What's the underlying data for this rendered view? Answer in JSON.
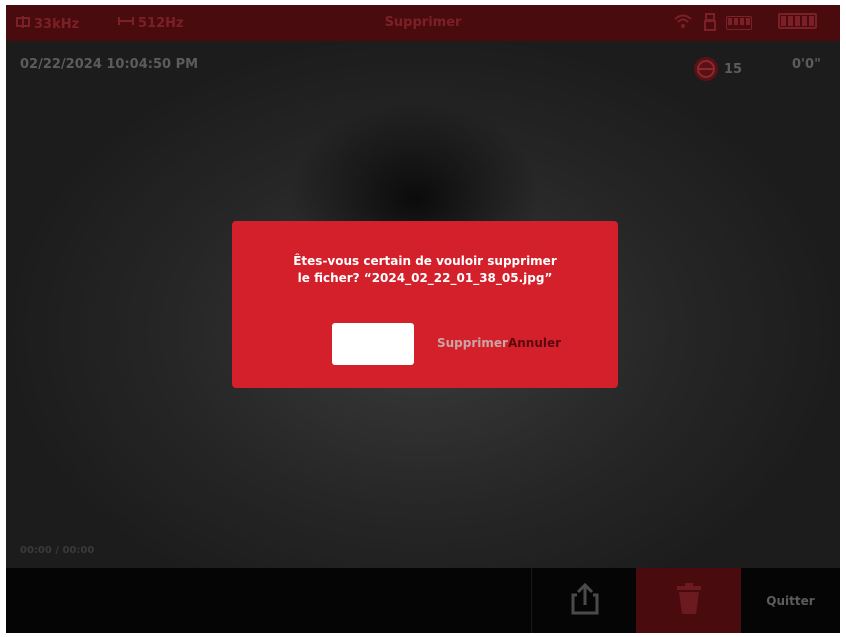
{
  "status_bar": {
    "frequency": "33kHz",
    "sonde_frequency": "512Hz",
    "title": "Supprimer"
  },
  "video_overlay": {
    "datetime": "02/22/2024 10:04:50 PM",
    "tilt_value": "15",
    "distance": "0'0\"",
    "bottom_caption": "00:00  /  00:00"
  },
  "dialog": {
    "message_line1": "Êtes-vous certain de vouloir supprimer",
    "message_line2": "le ficher? “2024_02_22_01_38_05.jpg”",
    "confirm_label": "Supprimer",
    "cancel_label": "Annuler"
  },
  "bottom_bar": {
    "quit_label": "Quitter"
  },
  "colors": {
    "dialog_bg": "#d4202a",
    "delete_selected_bg": "#4a0b0f",
    "top_bar_bg": "#4a0b0f",
    "confirm_text": "#c9a6a6",
    "cancel_text": "#5a0a0f"
  },
  "icons": [
    "frequency-icon",
    "sonde-icon",
    "wifi-icon",
    "usb-icon",
    "battery-icon",
    "tilt-icon",
    "share-icon",
    "trash-icon"
  ]
}
